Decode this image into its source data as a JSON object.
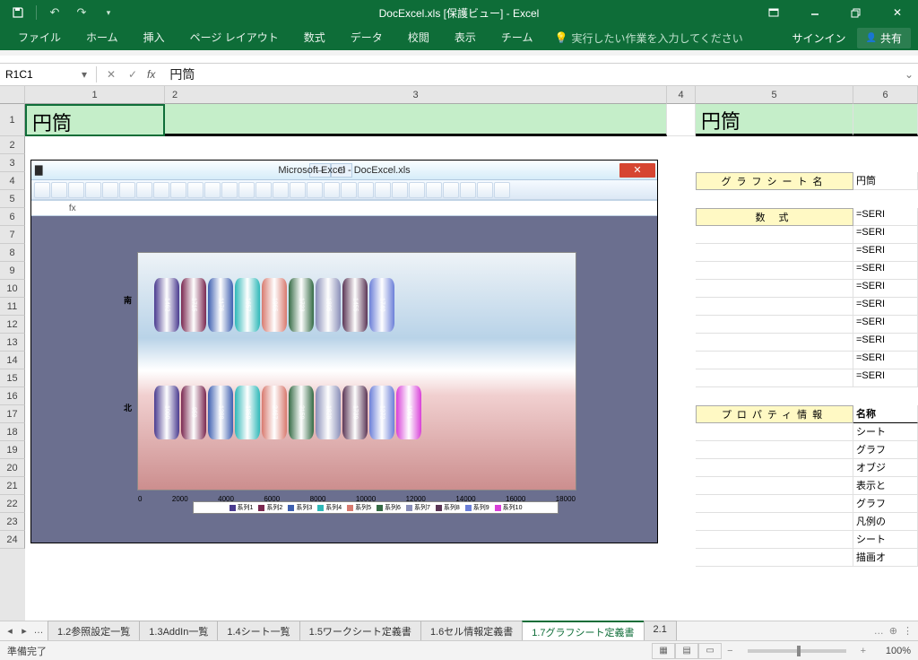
{
  "titlebar": {
    "text": "DocExcel.xls [保護ビュー] - Excel"
  },
  "ribbon": {
    "tabs": [
      "ファイル",
      "ホーム",
      "挿入",
      "ページ レイアウト",
      "数式",
      "データ",
      "校閲",
      "表示",
      "チーム"
    ],
    "tellme": "実行したい作業を入力してください",
    "signin": "サインイン",
    "share": "共有"
  },
  "namebox": "R1C1",
  "formula": "円筒",
  "colhdrs": [
    "1",
    "2",
    "3",
    "4",
    "5",
    "6"
  ],
  "rowcount": 24,
  "bigcells": {
    "a1": "円筒",
    "e1": "円筒"
  },
  "labels": {
    "graphsheet": "グラフシート名",
    "formula_lbl": "数 式",
    "property": "プロパティ情報"
  },
  "rightvals": {
    "graphsheet_val": "円筒",
    "seri": "=SERI",
    "prop_hdr": "名称",
    "props": [
      "シート",
      "グラフ",
      "オブジ",
      "表示と",
      "グラフ",
      "凡例の",
      "シート",
      "描画オ"
    ]
  },
  "embed": {
    "title": "Microsoft Excel - DocExcel.xls",
    "south_lbl": "南",
    "north_lbl": "北",
    "xticks": [
      "0",
      "2000",
      "4000",
      "6000",
      "8000",
      "10000",
      "12000",
      "14000",
      "16000",
      "18000"
    ],
    "legend": [
      "系列1",
      "系列2",
      "系列3",
      "系列4",
      "系列5",
      "系列6",
      "系列7",
      "系列8",
      "系列9",
      "系列10"
    ]
  },
  "chart_data": {
    "type": "bar",
    "categories": [
      "南",
      "北"
    ],
    "series": [
      {
        "name": "系列1",
        "values": [
          1462,
          1000
        ]
      },
      {
        "name": "系列2",
        "values": [
          1715,
          959
        ]
      },
      {
        "name": "系列3",
        "values": [
          1176,
          1288
        ]
      },
      {
        "name": "系列4",
        "values": [
          1657,
          1859
        ]
      },
      {
        "name": "系列5",
        "values": [
          1965,
          2467
        ]
      },
      {
        "name": "系列6",
        "values": [
          1723,
          2159
        ]
      },
      {
        "name": "系列7",
        "values": [
          1805,
          1828
        ]
      },
      {
        "name": "系列8",
        "values": [
          1455,
          1739
        ]
      },
      {
        "name": "系列9",
        "values": [
          1740,
          1272
        ]
      },
      {
        "name": "系列10",
        "values": [
          null,
          1061
        ]
      }
    ],
    "xlabel": "",
    "ylabel": "",
    "xlim": [
      0,
      18000
    ]
  },
  "sheets": {
    "nav": "…",
    "tabs": [
      "1.2参照設定一覧",
      "1.3AddIn一覧",
      "1.4シート一覧",
      "1.5ワークシート定義書",
      "1.6セル情報定義書",
      "1.7グラフシート定義書",
      "2.1"
    ],
    "active_index": 5,
    "more": "…"
  },
  "status": {
    "ready": "準備完了",
    "zoom": "100%"
  }
}
